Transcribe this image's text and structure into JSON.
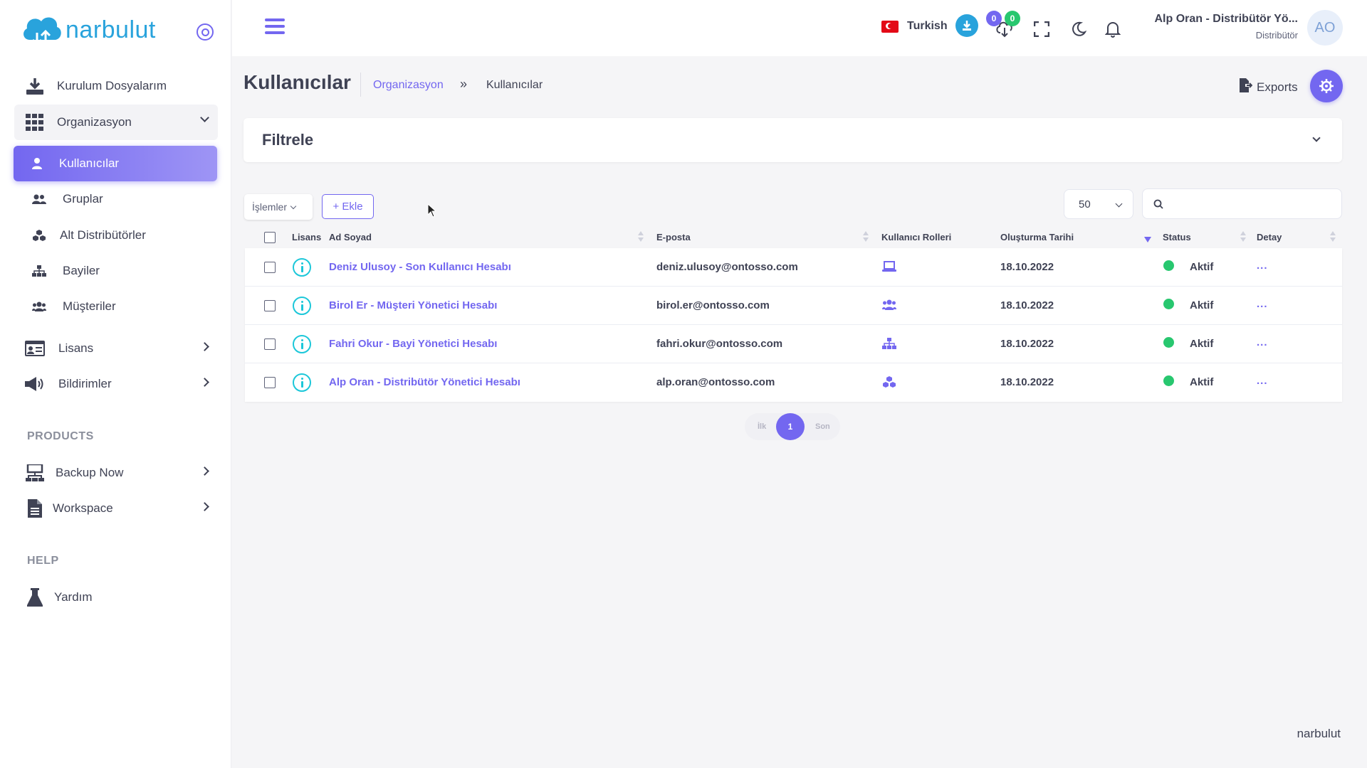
{
  "brand": {
    "logo_text": "narbulut",
    "footer": "narbulut"
  },
  "sidebar": {
    "items": [
      {
        "label": "Kurulum Dosyalarım",
        "icon": "download-icon"
      },
      {
        "label": "Organizasyon",
        "icon": "grid-icon",
        "expanded": true
      },
      {
        "label": "Kullanıcılar",
        "icon": "user-icon",
        "active": true
      },
      {
        "label": "Gruplar",
        "icon": "users-group-icon"
      },
      {
        "label": "Alt Distribütörler",
        "icon": "cubes-icon"
      },
      {
        "label": "Bayiler",
        "icon": "sitemap-icon"
      },
      {
        "label": "Müşteriler",
        "icon": "customers-icon"
      },
      {
        "label": "Lisans",
        "icon": "id-card-icon"
      },
      {
        "label": "Bildirimler",
        "icon": "megaphone-icon"
      }
    ],
    "sections": [
      {
        "label": "PRODUCTS",
        "items": [
          {
            "label": "Backup Now",
            "icon": "network-icon"
          },
          {
            "label": "Workspace",
            "icon": "document-icon"
          }
        ]
      },
      {
        "label": "HELP",
        "items": [
          {
            "label": "Yardım",
            "icon": "flask-icon"
          }
        ]
      }
    ]
  },
  "header": {
    "language": "Turkish",
    "badges": {
      "blue": "0",
      "green": "0"
    },
    "user_name": "Alp Oran - Distribütör Yö...",
    "user_role": "Distribütör",
    "avatar_initials": "AO",
    "colors": {
      "accent": "#7367f0",
      "download": "#29a3dc",
      "badge_blue": "#7367f0",
      "badge_green": "#28c76f"
    }
  },
  "page": {
    "title": "Kullanıcılar",
    "breadcrumb": {
      "parent": "Organizasyon",
      "separator": "»",
      "current": "Kullanıcılar"
    },
    "exports_label": "Exports"
  },
  "filter": {
    "title": "Filtrele"
  },
  "toolbar": {
    "actions_label": "İşlemler",
    "add_label": "+ Ekle",
    "page_size": "50",
    "search_placeholder": ""
  },
  "table": {
    "columns": [
      "Lisans",
      "Ad Soyad",
      "E-posta",
      "Kullanıcı Rolleri",
      "Oluşturma Tarihi",
      "Status",
      "Detay"
    ],
    "rows": [
      {
        "name": "Deniz Ulusoy - Son Kullanıcı Hesabı",
        "email": "deniz.ulusoy@ontosso.com",
        "role_icon": "laptop-icon",
        "created": "18.10.2022",
        "status": "Aktif",
        "detail": "..."
      },
      {
        "name": "Birol Er - Müşteri Yönetici Hesabı",
        "email": "birol.er@ontosso.com",
        "role_icon": "users-group-icon",
        "created": "18.10.2022",
        "status": "Aktif",
        "detail": "..."
      },
      {
        "name": "Fahri Okur - Bayi Yönetici Hesabı",
        "email": "fahri.okur@ontosso.com",
        "role_icon": "sitemap-icon",
        "created": "18.10.2022",
        "status": "Aktif",
        "detail": "..."
      },
      {
        "name": "Alp Oran - Distribütör Yönetici Hesabı",
        "email": "alp.oran@ontosso.com",
        "role_icon": "cubes-icon",
        "created": "18.10.2022",
        "status": "Aktif",
        "detail": "..."
      }
    ]
  },
  "pagination": {
    "first": "İlk",
    "current": "1",
    "last": "Son"
  }
}
